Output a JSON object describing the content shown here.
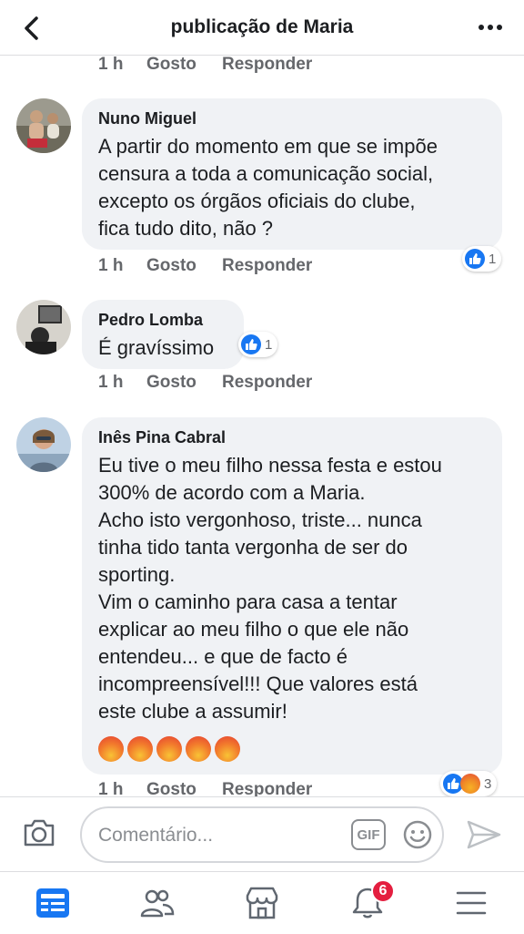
{
  "header": {
    "title": "publicação de Maria"
  },
  "actions": {
    "like": "Gosto",
    "reply": "Responder"
  },
  "comments": [
    {
      "time": "1 h"
    },
    {
      "author": "Nuno Miguel",
      "text": "A partir do momento em que se impõe\ncensura a toda a comunicação social,\nexcepto os órgãos oficiais do clube,\nfica tudo dito, não ?",
      "time": "1 h",
      "reactions": {
        "icons": [
          "like-icon"
        ],
        "count": "1"
      }
    },
    {
      "author": "Pedro Lomba",
      "text": "É gravíssimo",
      "time": "1 h",
      "reactions": {
        "icons": [
          "like-icon"
        ],
        "count": "1"
      }
    },
    {
      "author": "Inês Pina Cabral",
      "text": "Eu tive o meu filho nessa festa e estou\n300% de acordo com a Maria.\nAcho isto vergonhoso, triste... nunca\ntinha tido tanta vergonha de ser do\nsporting.\nVim o caminho para casa a tentar\nexplicar ao meu filho o que ele não\nentendeu... e que de facto é\nincompreensível!!! Que valores está\neste clube a assumir!",
      "emojis": [
        "angry-face",
        "angry-face",
        "angry-face",
        "angry-face",
        "angry-face"
      ],
      "time": "1 h",
      "reactions": {
        "icons": [
          "like-icon",
          "angry-icon"
        ],
        "count": "3"
      }
    }
  ],
  "composer": {
    "placeholder": "Comentário...",
    "gif_label": "GIF"
  },
  "nav": {
    "notifications_badge": "6"
  },
  "colors": {
    "accent": "#1877f2",
    "badge": "#e41e3f",
    "bubble": "#f0f2f5",
    "muted": "#65676b"
  }
}
